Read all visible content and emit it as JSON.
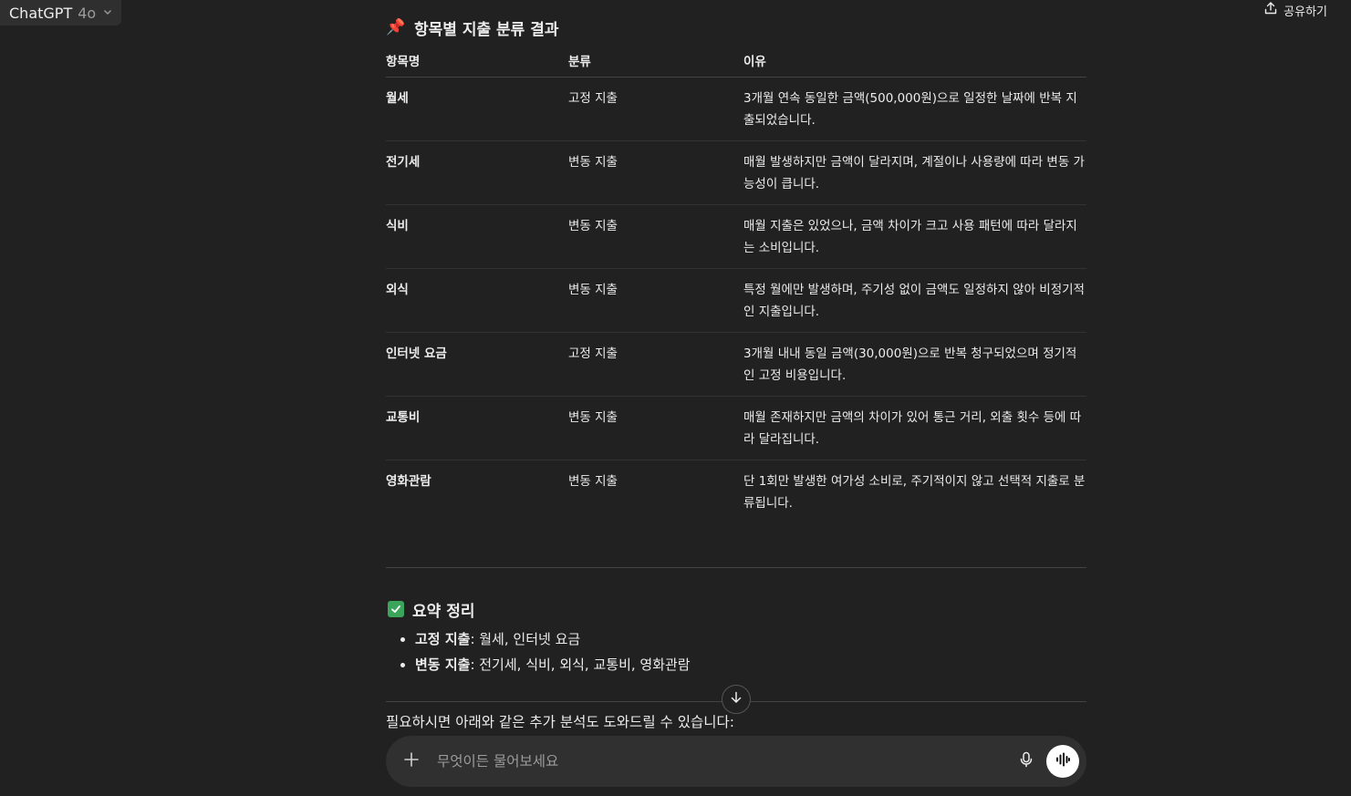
{
  "header": {
    "model_name": "ChatGPT",
    "model_version": "4o",
    "share_label": "공유하기"
  },
  "classification": {
    "emoji": "📌",
    "title": "항목별 지출 분류 결과",
    "columns": [
      "항목명",
      "분류",
      "이유"
    ],
    "rows": [
      {
        "name": "월세",
        "type": "고정 지출",
        "reason": "3개월 연속 동일한 금액(500,000원)으로 일정한 날짜에 반복 지출되었습니다."
      },
      {
        "name": "전기세",
        "type": "변동 지출",
        "reason": "매월 발생하지만 금액이 달라지며, 계절이나 사용량에 따라 변동 가능성이 큽니다."
      },
      {
        "name": "식비",
        "type": "변동 지출",
        "reason": "매월 지출은 있었으나, 금액 차이가 크고 사용 패턴에 따라 달라지는 소비입니다."
      },
      {
        "name": "외식",
        "type": "변동 지출",
        "reason": "특정 월에만 발생하며, 주기성 없이 금액도 일정하지 않아 비정기적인 지출입니다."
      },
      {
        "name": "인터넷 요금",
        "type": "고정 지출",
        "reason": "3개월 내내 동일 금액(30,000원)으로 반복 청구되었으며 정기적인 고정 비용입니다."
      },
      {
        "name": "교통비",
        "type": "변동 지출",
        "reason": "매월 존재하지만 금액의 차이가 있어 통근 거리, 외출 횟수 등에 따라 달라집니다."
      },
      {
        "name": "영화관람",
        "type": "변동 지출",
        "reason": "단 1회만 발생한 여가성 소비로, 주기적이지 않고 선택적 지출로 분류됩니다."
      }
    ]
  },
  "summary": {
    "title": "요약 정리",
    "items": [
      {
        "key": "고정 지출",
        "value": ": 월세, 인터넷 요금"
      },
      {
        "key": "변동 지출",
        "value": ": 전기세, 식비, 외식, 교통비, 영화관람"
      }
    ]
  },
  "followup_text": "필요하시면 아래와 같은 추가 분석도 도와드릴 수 있습니다:",
  "composer": {
    "placeholder": "무엇이든 물어보세요"
  }
}
